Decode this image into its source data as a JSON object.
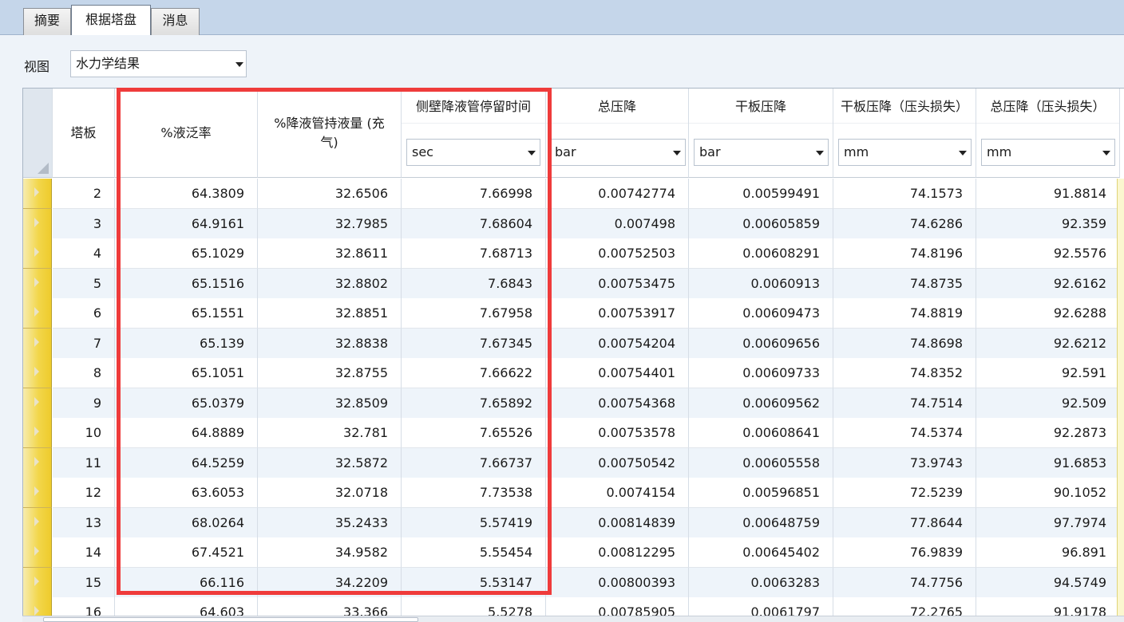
{
  "tabs": [
    {
      "label": "摘要"
    },
    {
      "label": "根据塔盘"
    },
    {
      "label": "消息"
    }
  ],
  "view": {
    "label": "视图",
    "selected": "水力学结果"
  },
  "columns": [
    {
      "title": "塔板",
      "unit": ""
    },
    {
      "title": "%液泛率",
      "unit": ""
    },
    {
      "title": "%降液管持液量 (充气)",
      "unit": ""
    },
    {
      "title": "侧壁降液管停留时间",
      "unit": "sec"
    },
    {
      "title": "总压降",
      "unit": "bar"
    },
    {
      "title": "干板压降",
      "unit": "bar"
    },
    {
      "title": "干板压降（压头损失）",
      "unit": "mm"
    },
    {
      "title": "总压降（压头损失）",
      "unit": "mm"
    }
  ],
  "rows": [
    [
      "2",
      "64.3809",
      "32.6506",
      "7.66998",
      "0.00742774",
      "0.00599491",
      "74.1573",
      "91.8814"
    ],
    [
      "3",
      "64.9161",
      "32.7985",
      "7.68604",
      "0.007498",
      "0.00605859",
      "74.6286",
      "92.359"
    ],
    [
      "4",
      "65.1029",
      "32.8611",
      "7.68713",
      "0.00752503",
      "0.00608291",
      "74.8196",
      "92.5576"
    ],
    [
      "5",
      "65.1516",
      "32.8802",
      "7.6843",
      "0.00753475",
      "0.0060913",
      "74.8735",
      "92.6162"
    ],
    [
      "6",
      "65.1551",
      "32.8851",
      "7.67958",
      "0.00753917",
      "0.00609473",
      "74.8819",
      "92.6288"
    ],
    [
      "7",
      "65.139",
      "32.8838",
      "7.67345",
      "0.00754204",
      "0.00609656",
      "74.8698",
      "92.6212"
    ],
    [
      "8",
      "65.1051",
      "32.8755",
      "7.66622",
      "0.00754401",
      "0.00609733",
      "74.8352",
      "92.591"
    ],
    [
      "9",
      "65.0379",
      "32.8509",
      "7.65892",
      "0.00754368",
      "0.00609562",
      "74.7514",
      "92.509"
    ],
    [
      "10",
      "64.8889",
      "32.781",
      "7.65526",
      "0.00753578",
      "0.00608641",
      "74.5374",
      "92.2873"
    ],
    [
      "11",
      "64.5259",
      "32.5872",
      "7.66737",
      "0.00750542",
      "0.00605558",
      "73.9743",
      "91.6853"
    ],
    [
      "12",
      "63.6053",
      "32.0718",
      "7.73538",
      "0.0074154",
      "0.00596851",
      "72.5239",
      "90.1052"
    ],
    [
      "13",
      "68.0264",
      "35.2433",
      "5.57419",
      "0.00814839",
      "0.00648759",
      "77.8644",
      "97.7974"
    ],
    [
      "14",
      "67.4521",
      "34.9582",
      "5.55454",
      "0.00812295",
      "0.00645402",
      "76.9839",
      "96.891"
    ],
    [
      "15",
      "66.116",
      "34.2209",
      "5.53147",
      "0.00800393",
      "0.0063283",
      "74.7756",
      "94.5749"
    ],
    [
      "16",
      "64.603",
      "33.366",
      "5.5278",
      "0.00785905",
      "0.0061797",
      "72.2765",
      "91.9178"
    ]
  ]
}
